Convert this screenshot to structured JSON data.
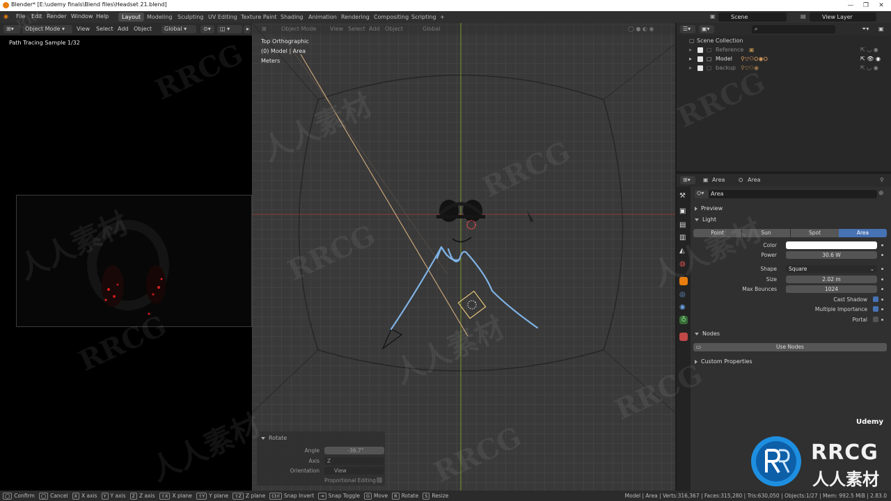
{
  "window": {
    "title": "Blender* [E:\\udemy finals\\Blend files\\Headset 21.blend]",
    "minimize": "—",
    "restore": "❐",
    "close": "✕"
  },
  "menu": [
    "File",
    "Edit",
    "Render",
    "Window",
    "Help"
  ],
  "workspaces": [
    "Layout",
    "Modeling",
    "Sculpting",
    "UV Editing",
    "Texture Paint",
    "Shading",
    "Animation",
    "Rendering",
    "Compositing",
    "Scripting",
    "+"
  ],
  "scene": {
    "scene_name": "Scene",
    "view_layer": "View Layer"
  },
  "left_header": {
    "mode": "Object Mode",
    "view": "View",
    "select": "Select",
    "add": "Add",
    "object": "Object",
    "orientation": "Global"
  },
  "render_view": {
    "status": "Path Tracing Sample 1/32"
  },
  "viewport": {
    "header": [
      "Object Mode",
      "View",
      "Select",
      "Add",
      "Object",
      "Global"
    ],
    "info": [
      "Top Orthographic",
      "(0) Model | Area",
      "Meters"
    ]
  },
  "operator_panel": {
    "title": "Rotate",
    "angle_label": "Angle",
    "angle_value": "-36.7°",
    "axis_label": "Axis",
    "axis_value": "Z",
    "orientation_label": "Orientation",
    "orientation_value": "View",
    "proportional": "Proportional Editing"
  },
  "outliner": {
    "collection": "Scene Collection",
    "items": [
      {
        "name": "Reference"
      },
      {
        "name": "Model"
      },
      {
        "name": "backup"
      }
    ]
  },
  "properties": {
    "header_object": "Area",
    "header_data": "Area",
    "datablock": "Area",
    "preview_label": "Preview",
    "light_label": "Light",
    "light_types": [
      "Point",
      "Sun",
      "Spot",
      "Area"
    ],
    "active_light_type": "Area",
    "color_label": "Color",
    "color_value": "#ffffff",
    "power_label": "Power",
    "power_value": "30.6 W",
    "shape_label": "Shape",
    "shape_value": "Square",
    "size_label": "Size",
    "size_value": "2.02 m",
    "bounces_label": "Max Bounces",
    "bounces_value": "1024",
    "cast_shadow": "Cast Shadow",
    "multiple_importance": "Multiple Importance",
    "portal": "Portal",
    "nodes_label": "Nodes",
    "use_nodes": "Use Nodes",
    "custom_props": "Custom Properties"
  },
  "statusbar": {
    "hints": [
      {
        "key": "◯",
        "text": "Confirm"
      },
      {
        "key": "◯",
        "text": "Cancel"
      },
      {
        "key": "X",
        "text": "X axis"
      },
      {
        "key": "Y",
        "text": "Y axis"
      },
      {
        "key": "Z",
        "text": "Z axis"
      },
      {
        "key": "⇧X",
        "text": "X plane"
      },
      {
        "key": "⇧Y",
        "text": "Y plane"
      },
      {
        "key": "⇧Z",
        "text": "Z plane"
      },
      {
        "key": "Ctrl",
        "text": "Snap Invert"
      },
      {
        "key": "⇥",
        "text": "Snap Toggle"
      },
      {
        "key": "G",
        "text": "Move"
      },
      {
        "key": "R",
        "text": "Rotate"
      },
      {
        "key": "S",
        "text": "Resize"
      }
    ],
    "stats": "Model | Area | Verts:316,367 | Faces:315,280 | Tris:630,050 | Objects:1/27 | Mem: 992.5 MiB | 2.83.0"
  },
  "watermarks": {
    "rrcg": "RRCG",
    "cn": "人人素材",
    "udemy": "Udemy"
  },
  "colors": {
    "accent": "#4772b3",
    "blender_orange": "#e87d0d",
    "annotation": "#7fb3e6",
    "brand_blue": "#1e8fe0"
  }
}
